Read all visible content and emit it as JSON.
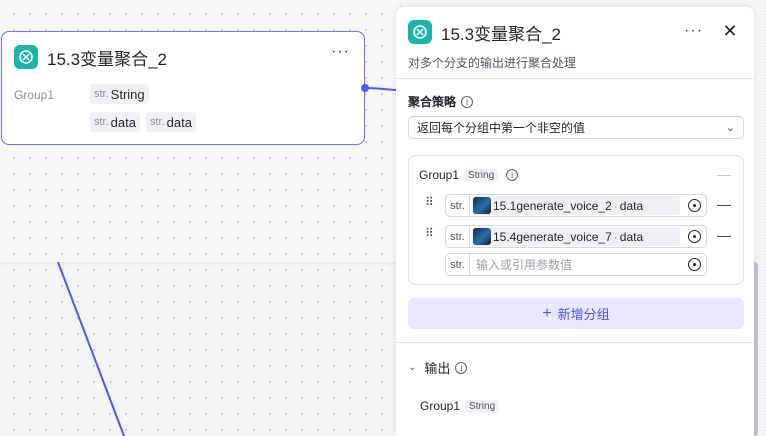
{
  "colors": {
    "accent": "#6b6cf7",
    "app_icon": "#1bb5a7",
    "edge": "#5454f0",
    "add_button_bg": "#e9e8ff",
    "add_button_text": "#4d53e8"
  },
  "node": {
    "title": "15.3变量聚合_2",
    "more_label": "···",
    "group_label": "Group1",
    "output_type": {
      "prefix": "str.",
      "label": "String"
    },
    "inputs": [
      {
        "prefix": "str.",
        "label": "data"
      },
      {
        "prefix": "str.",
        "label": "data"
      }
    ]
  },
  "panel": {
    "title": "15.3变量聚合_2",
    "more_label": "···",
    "close_label": "✕",
    "description": "对多个分支的输出进行聚合处理",
    "strategy": {
      "label": "聚合策略",
      "info_icon": "ⓘ",
      "selected": "返回每个分组中第一个非空的值",
      "chevron": "⌄"
    },
    "group": {
      "name": "Group1",
      "type": "String",
      "info_icon": "ⓘ",
      "remove_label": "—",
      "rows": [
        {
          "prefix": "str.",
          "source": "15.1generate_voice_2",
          "sep": "·",
          "field": "data"
        },
        {
          "prefix": "str.",
          "source": "15.4generate_voice_7",
          "sep": "·",
          "field": "data"
        }
      ],
      "empty_row": {
        "prefix": "str.",
        "placeholder": "输入或引用参数值"
      }
    },
    "add_group_label": "新增分组",
    "add_group_icon": "+",
    "output": {
      "label": "输出",
      "info_icon": "ⓘ",
      "chevron": "⌄",
      "items": [
        {
          "name": "Group1",
          "type": "String"
        }
      ]
    }
  }
}
